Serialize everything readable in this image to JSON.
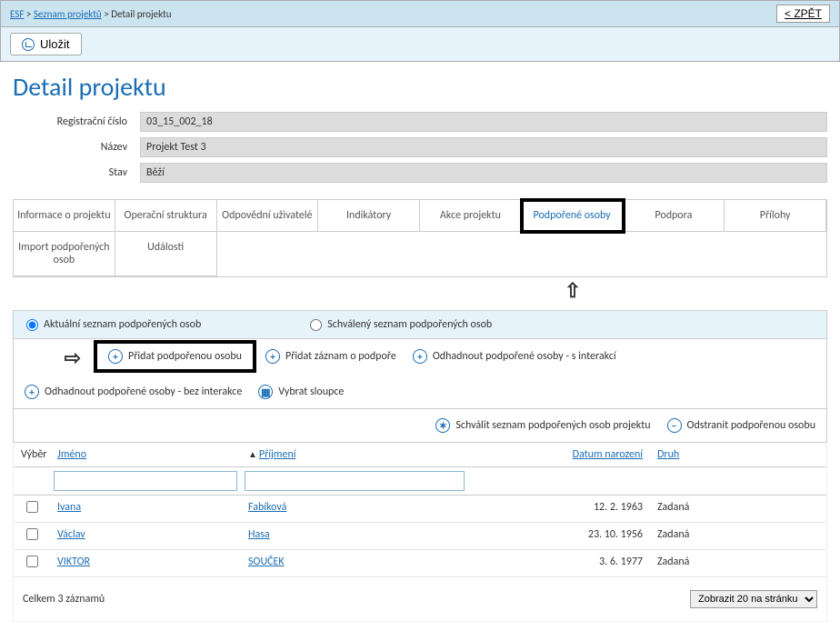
{
  "breadcrumbs": {
    "root": "ESF",
    "sep": ">",
    "l1": "Seznam projektů",
    "l2": "Detail projektu"
  },
  "back_btn": "< ZPĚT",
  "toolbar": {
    "save": "Uložit"
  },
  "page_title": "Detail projektu",
  "form": {
    "reg_label": "Registrační číslo",
    "reg_value": "03_15_002_18",
    "name_label": "Název",
    "name_value": "Projekt Test 3",
    "state_label": "Stav",
    "state_value": "Běží"
  },
  "tabs": {
    "info": "Informace o projektu",
    "struct": "Operační struktura",
    "users": "Odpovědní uživatelé",
    "indic": "Indikátory",
    "actions": "Akce projektu",
    "persons": "Podpořené osoby",
    "support": "Podpora",
    "attach": "Přílohy",
    "import": "Import podpořených osob",
    "events": "Události"
  },
  "radios": {
    "current": "Aktuální seznam podpořených osob",
    "approved": "Schválený seznam podpořených osob"
  },
  "actions": {
    "add_person": "Přidat podpořenou osobu",
    "add_record": "Přidat záznam o podpoře",
    "estimate_int": "Odhadnout podpořené osoby - s interakcí",
    "estimate_noint": "Odhadnout podpořené osoby - bez interakce",
    "columns": "Vybrat sloupce",
    "approve": "Schválit seznam podpořených osob projektu",
    "remove": "Odstranit podpořenou osobu"
  },
  "grid": {
    "headers": {
      "select": "Výběr",
      "name": "Jméno",
      "surname": "Příjmení",
      "birth": "Datum narození",
      "type": "Druh"
    },
    "rows": [
      {
        "name": "Ivana",
        "surname": "Fabíková",
        "birth": "12. 2. 1963",
        "type": "Zadaná"
      },
      {
        "name": "Václav",
        "surname": "Hasa",
        "birth": "23. 10. 1956",
        "type": "Zadaná"
      },
      {
        "name": "VIKTOR",
        "surname": "SOUČEK",
        "birth": "3. 6. 1977",
        "type": "Zadaná"
      }
    ],
    "total": "Celkem 3 záznamů",
    "page_size": "Zobrazit 20 na stránku"
  }
}
